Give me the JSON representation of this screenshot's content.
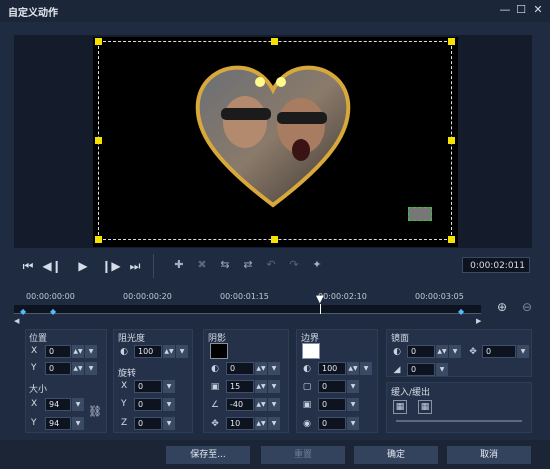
{
  "window": {
    "title": "自定义动作",
    "minimize": "—",
    "maximize": "☐",
    "close": "✕"
  },
  "playback": {
    "timecode": "0:00:02:011"
  },
  "timeline": {
    "labels": [
      "00:00:00:00",
      "00:00:00:20",
      "00:00:01:15",
      "00:00:02:10",
      "00:00:03:05"
    ]
  },
  "position": {
    "title": "位置",
    "x_label": "X",
    "x": "0",
    "y_label": "Y",
    "y": "0"
  },
  "size": {
    "title": "大小",
    "x_label": "X",
    "x": "94",
    "y_label": "Y",
    "y": "94"
  },
  "opacity": {
    "title": "阻光度",
    "value": "100"
  },
  "rotation": {
    "title": "旋转",
    "x_label": "X",
    "x": "0",
    "y_label": "Y",
    "y": "0",
    "z_label": "Z",
    "z": "0"
  },
  "shadow": {
    "title": "阴影",
    "opacity": "0",
    "blur": "15",
    "angle": "-40",
    "distance": "10",
    "color": "#000000"
  },
  "border": {
    "title": "边界",
    "opacity": "100",
    "width": "0",
    "blur": "0",
    "softness": "0",
    "color": "#ffffff"
  },
  "mirror": {
    "title": "镜面",
    "value1": "0",
    "value2": "0",
    "value3": "0"
  },
  "ease": {
    "title": "缓入/缓出"
  },
  "buttons": {
    "save_to": "保存至...",
    "reset": "重置",
    "ok": "确定",
    "cancel": "取消"
  }
}
